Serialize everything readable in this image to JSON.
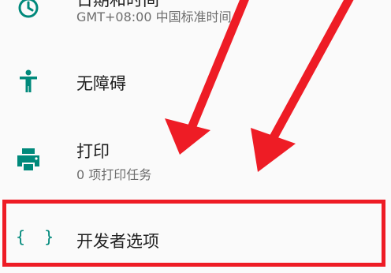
{
  "settings": {
    "items": [
      {
        "id": "datetime",
        "title": "日期和时间",
        "subtitle": "GMT+08:00 中国标准时间",
        "icon": "clock-icon"
      },
      {
        "id": "accessibility",
        "title": "无障碍",
        "icon": "accessibility-icon"
      },
      {
        "id": "printing",
        "title": "打印",
        "subtitle": "0 项打印任务",
        "icon": "printer-icon"
      },
      {
        "id": "developer",
        "title": "开发者选项",
        "icon": "code-braces-icon",
        "icon_glyph": "{ }"
      }
    ]
  },
  "colors": {
    "accent": "#00897b",
    "annotation": "#ee1c25",
    "background": "#fafafa",
    "title_text": "#1f1f1f",
    "subtitle_text": "#6e6e6e"
  }
}
